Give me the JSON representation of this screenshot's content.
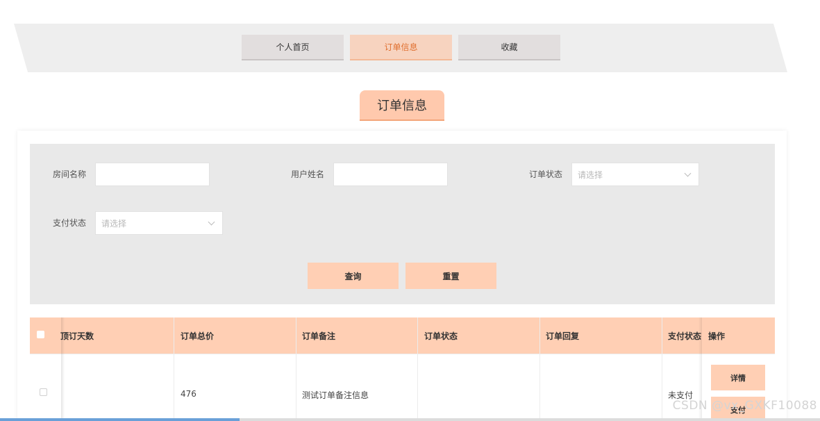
{
  "nav": {
    "tabs": [
      {
        "label": "个人首页",
        "active": false
      },
      {
        "label": "订单信息",
        "active": true
      },
      {
        "label": "收藏",
        "active": false
      }
    ]
  },
  "section_title": "订单信息",
  "search": {
    "room_name_label": "房间名称",
    "room_name_value": "",
    "user_name_label": "用户姓名",
    "user_name_value": "",
    "order_status_label": "订单状态",
    "order_status_placeholder": "请选择",
    "pay_status_label": "支付状态",
    "pay_status_placeholder": "请选择",
    "query_label": "查询",
    "reset_label": "重置"
  },
  "table": {
    "columns": [
      "顶订天数",
      "订单总价",
      "订单备注",
      "订单状态",
      "订单回复",
      "支付状态",
      "操作"
    ],
    "rows": [
      {
        "days": "",
        "total": "476",
        "remark": "测试订单备注信息",
        "status": "",
        "reply": "",
        "pay_status": "未支付",
        "actions": [
          "详情",
          "支付"
        ]
      }
    ]
  },
  "watermark": "CSDN @vx_GXKF10088",
  "colors": {
    "accent": "#ffcfb4",
    "active_text": "#e07030",
    "panel_bg": "#e9e9e9"
  }
}
